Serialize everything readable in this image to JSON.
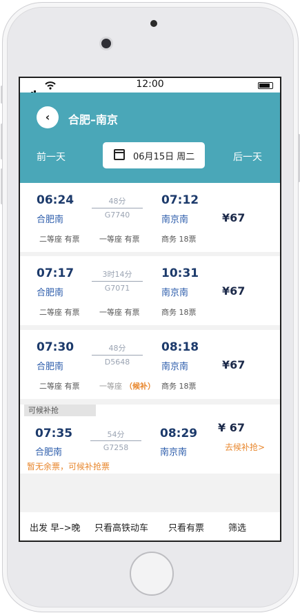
{
  "status": {
    "time": "12:00"
  },
  "header": {
    "route": "合肥–南京",
    "prev_day": "前一天",
    "next_day": "后一天",
    "date": "06月15日 周二"
  },
  "trains": [
    {
      "dep_time": "06:24",
      "dep_station": "合肥南",
      "duration": "48分",
      "train_no": "G7740",
      "arr_time": "07:12",
      "arr_station": "南京南",
      "price": "¥67",
      "seats": [
        "二等座 有票",
        "一等座 有票",
        "商务 18票"
      ]
    },
    {
      "dep_time": "07:17",
      "dep_station": "合肥南",
      "duration": "3时14分",
      "train_no": "G7071",
      "arr_time": "10:31",
      "arr_station": "南京南",
      "price": "¥67",
      "seats": [
        "二等座 有票",
        "一等座 有票",
        "商务 18票"
      ]
    },
    {
      "dep_time": "07:30",
      "dep_station": "合肥南",
      "duration": "48分",
      "train_no": "D5648",
      "arr_time": "08:18",
      "arr_station": "南京南",
      "price": "¥67",
      "seats": [
        "二等座 有票",
        "一等座",
        "（候补）",
        "商务 18票"
      ]
    },
    {
      "tag": "可候补抢",
      "dep_time": "07:35",
      "dep_station": "合肥南",
      "duration": "54分",
      "train_no": "G7258",
      "arr_time": "08:29",
      "arr_station": "南京南",
      "price": "¥ 67",
      "wait_link": "去候补抢>",
      "notice": "暂无余票，可候补抢票"
    }
  ],
  "bottom_bar": {
    "sort": "出发 早–>晚",
    "filter_hsr": "只看高铁动车",
    "filter_available": "只看有票",
    "filter": "筛选"
  },
  "colors": {
    "header": "#4aa7b8",
    "accent": "#e8872e",
    "text_dark": "#1c3a6b"
  }
}
